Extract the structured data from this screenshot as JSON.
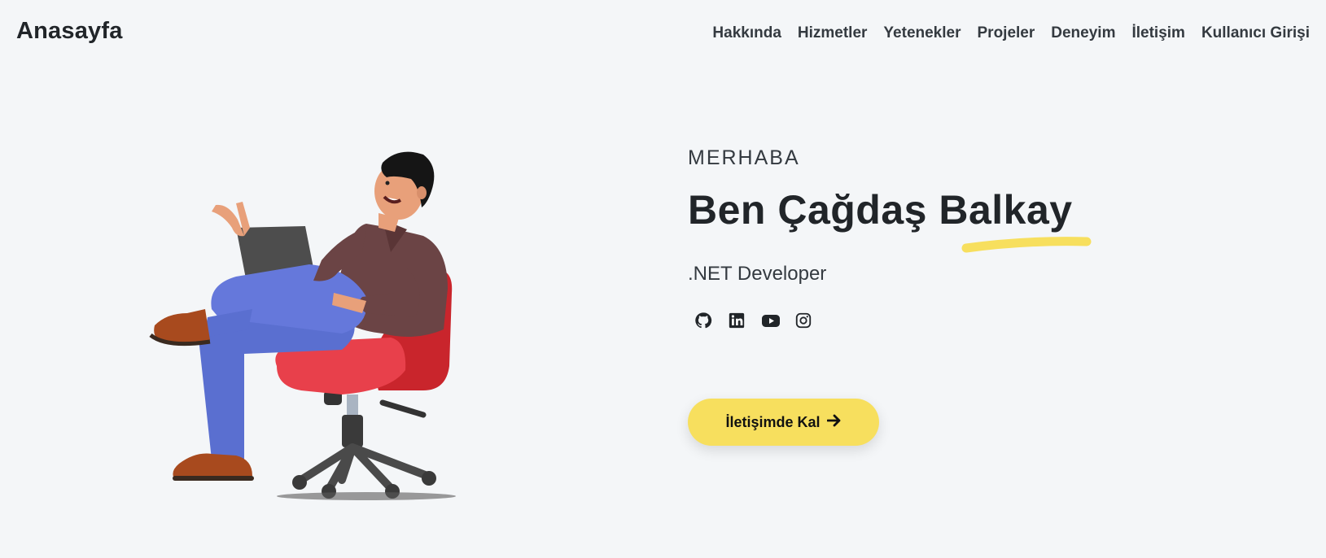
{
  "nav": {
    "brand": "Anasayfa",
    "links": [
      {
        "label": "Hakkında"
      },
      {
        "label": "Hizmetler"
      },
      {
        "label": "Yetenekler"
      },
      {
        "label": "Projeler"
      },
      {
        "label": "Deneyim"
      },
      {
        "label": "İletişim"
      },
      {
        "label": "Kullanıcı Girişi"
      }
    ]
  },
  "hero": {
    "greeting": "MERHABA",
    "name": "Ben Çağdaş Balkay",
    "role": ".NET Developer",
    "cta_label": "İletişimde Kal",
    "cta_icon": "arrow-right-icon",
    "socials": [
      {
        "icon": "github-icon"
      },
      {
        "icon": "linkedin-icon"
      },
      {
        "icon": "youtube-icon"
      },
      {
        "icon": "instagram-icon"
      }
    ]
  },
  "colors": {
    "background": "#f4f6f8",
    "accent_yellow": "#f7df5e",
    "text_dark": "#212529"
  }
}
